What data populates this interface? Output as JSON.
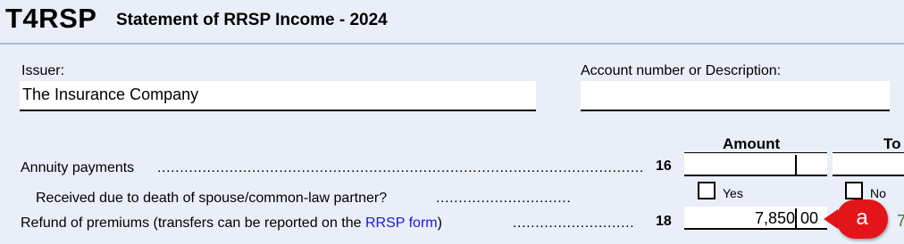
{
  "header": {
    "form_code": "T4RSP",
    "form_title": "Statement of RRSP Income - 2024"
  },
  "issuer": {
    "label": "Issuer:",
    "value": "The Insurance Company"
  },
  "account": {
    "label": "Account number or Description:",
    "value": ""
  },
  "columns": {
    "amount": "Amount",
    "total_partial": "To"
  },
  "rows": {
    "annuity": {
      "label": "Annuity payments",
      "leader": "...................................................................................................................",
      "box": "16",
      "dollars": "",
      "cents": ""
    },
    "death": {
      "label": "Received due to death of spouse/common-law partner?",
      "leader": "..............................",
      "yes_label": "Yes",
      "no_label": "No"
    },
    "refund": {
      "label_prefix": "Refund of premiums (transfers can be reported on the ",
      "link_text": "RRSP form",
      "label_suffix": ")",
      "leader": "...........................",
      "box": "18",
      "dollars": "7,850",
      "cents": "00",
      "second_partial": "7"
    }
  },
  "marker": {
    "label": "a",
    "color": "#e4141b"
  },
  "colors": {
    "background": "#e9eef8",
    "rule": "#a9bcd6",
    "link": "#1a1ad6"
  }
}
